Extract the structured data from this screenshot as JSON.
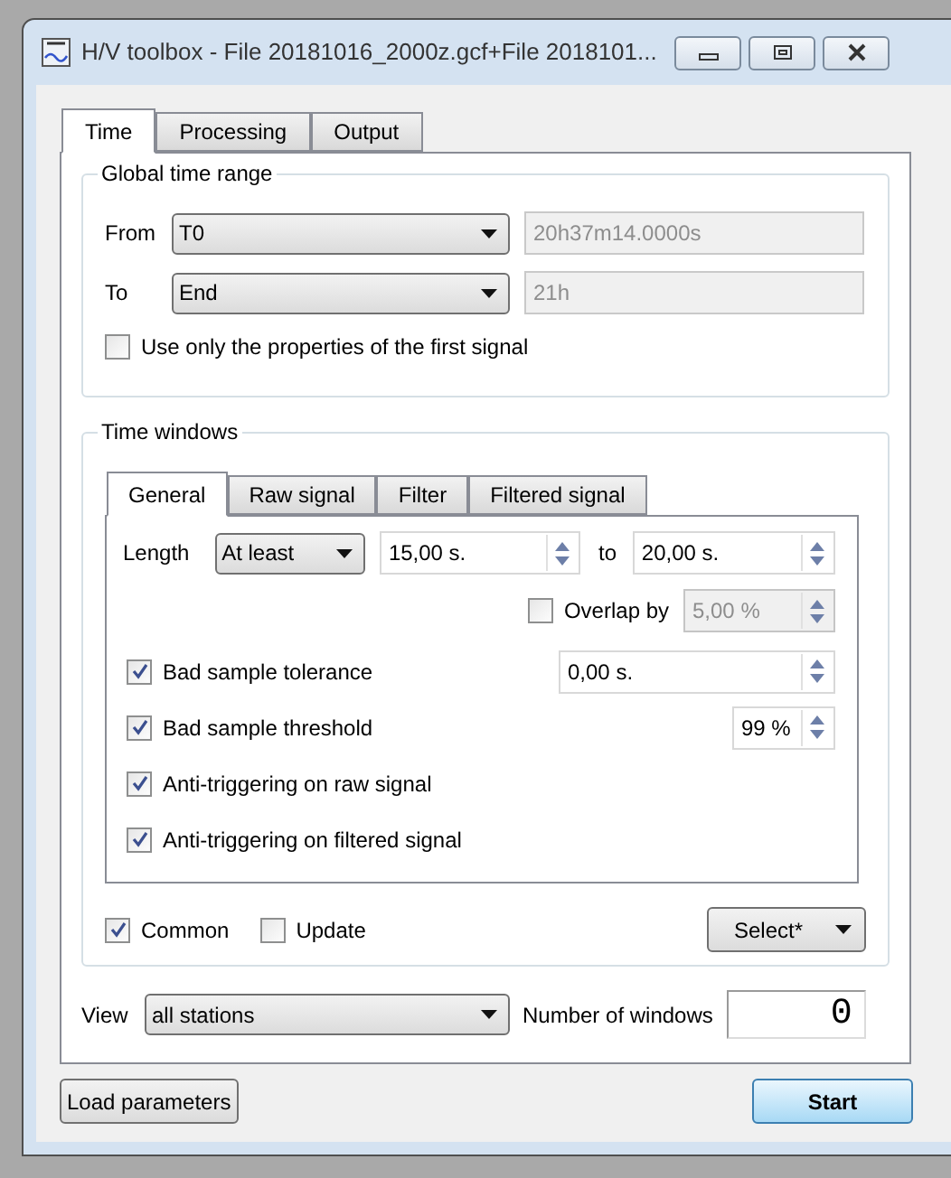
{
  "window": {
    "title": "H/V toolbox - File 20181016_2000z.gcf+File 2018101..."
  },
  "tabs": [
    {
      "label": "Time",
      "selected": true
    },
    {
      "label": "Processing",
      "selected": false
    },
    {
      "label": "Output",
      "selected": false
    }
  ],
  "global_time_range": {
    "title": "Global time range",
    "rows": [
      {
        "label": "From",
        "value": "T0",
        "time": "20h37m14.0000s",
        "time_disabled": true
      },
      {
        "label": "To",
        "value": "End",
        "time": "21h",
        "time_disabled": true
      }
    ],
    "first_signal_only": {
      "label": "Use only the properties of the first signal",
      "checked": false
    }
  },
  "time_windows": {
    "title": "Time windows",
    "tabs": [
      {
        "label": "General",
        "selected": true
      },
      {
        "label": "Raw signal",
        "selected": false
      },
      {
        "label": "Filter",
        "selected": false
      },
      {
        "label": "Filtered signal",
        "selected": false
      }
    ],
    "length": {
      "label": "Length",
      "mode": "At least",
      "min": "15,00 s.",
      "to_label": "to",
      "max": "20,00 s."
    },
    "overlap": {
      "label": "Overlap by",
      "checked": false,
      "value": "5,00 %",
      "disabled": true
    },
    "options": [
      {
        "kind": "wide_spin",
        "label": "Bad sample tolerance",
        "checked": true,
        "value": "0,00 s."
      },
      {
        "kind": "small_spin",
        "label": "Bad sample threshold",
        "checked": true,
        "value": "99 %"
      },
      {
        "kind": "plain",
        "label": "Anti-triggering on raw signal",
        "checked": true
      },
      {
        "kind": "plain",
        "label": "Anti-triggering on filtered signal",
        "checked": true
      }
    ],
    "common": {
      "label": "Common",
      "checked": true
    },
    "update": {
      "label": "Update",
      "checked": false
    },
    "select_button": "Select*"
  },
  "view": {
    "label": "View",
    "value": "all stations"
  },
  "number_of_windows": {
    "label": "Number of windows",
    "value": "0"
  },
  "buttons": {
    "load": "Load parameters",
    "start": "Start"
  }
}
